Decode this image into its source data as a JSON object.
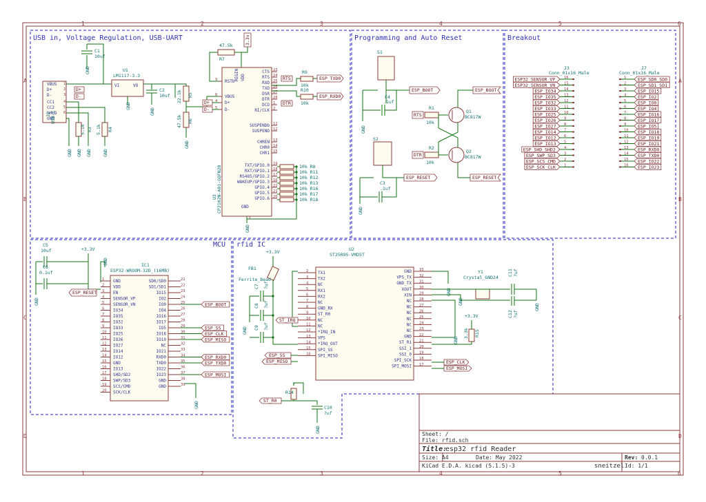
{
  "sections": {
    "usb": "USB in, Voltage Regulation, USB-UART",
    "prog": "Programming and Auto Reset",
    "breakout": "Breakout",
    "mcu": "MCU",
    "rfid": "rfid IC"
  },
  "grid": {
    "cols": [
      "1",
      "2",
      "3",
      "4",
      "5",
      "6"
    ],
    "rows": [
      "A",
      "B",
      "C",
      "D"
    ]
  },
  "usb": {
    "j2_ref": "J2",
    "j2_val": "USB-C",
    "j2_pins": [
      "VBUS",
      "D+",
      "D-",
      "CC1",
      "CC2",
      "SHLD",
      "GND"
    ],
    "j2_nums": [
      "1",
      "2",
      "3",
      "4",
      "5",
      "6"
    ],
    "u1_ref": "U1",
    "u1_val": "LM1117-3.3",
    "u1_vi": "VI",
    "u1_vo": "VO",
    "c1_ref": "C1",
    "c1_val": "10uf",
    "c2_ref": "C2",
    "c2_val": "10uf",
    "r5": "R5",
    "r5_val": "22.1k",
    "r6": "R6",
    "r6_val": "47.5k",
    "r3": "R3",
    "r3_val": "5.1k",
    "r4": "R4",
    "r4_val": "5.1k",
    "r7": "R7",
    "r7_val": "47.5k",
    "rail": "3.3v",
    "gnd": "GND",
    "dp": "D+",
    "dm": "D-",
    "u3_ref": "U3",
    "u3_val": "CP2102N-A01-GQFN28",
    "u3_left": [
      "REGIN",
      "VDD",
      "RSTb",
      "VBUS",
      "D+",
      "D-"
    ],
    "u3_left_nums": [
      "7",
      "6",
      "9",
      "8",
      "4",
      "5"
    ],
    "u3_right": [
      "CTS",
      "RTS",
      "RXD",
      "TXD",
      "DSR",
      "DTR",
      "DCD",
      "RI/CLK",
      "SUSPENDb",
      "SUSPEND",
      "CHREN",
      "CHR0",
      "CHR1",
      "TXT/GPIO.0",
      "RXT/GPIO.1",
      "RS485/GPIO.2",
      "WAKEUP/GPIO.3",
      "GPIO.4",
      "GPIO.5",
      "GPIO.6",
      "GND"
    ],
    "u3_right_nums": [
      "23",
      "24",
      "25",
      "26",
      "27",
      "28",
      "1",
      "2",
      "11",
      "12",
      "13",
      "14",
      "15",
      "19",
      "18",
      "17",
      "16",
      "22",
      "21",
      "20",
      "3"
    ],
    "r8_r18": [
      "10k R8",
      "10k R11",
      "10k R12",
      "10k R13",
      "10k R16",
      "10k R17",
      "10k R18"
    ],
    "r9": "R9",
    "r9_val": "10k",
    "r10": "R10",
    "r10_val": "10k",
    "esp_txd0": "ESP_TXD0",
    "esp_rxd0": "ESP_RXD0",
    "rts": "RTS",
    "dtr": "DTR"
  },
  "prog": {
    "s1": "S1",
    "s2": "S2",
    "c4": "C4",
    "c4_val": ".1uf",
    "c3": "C3",
    "c3_val": ".1uf",
    "r1": "R1",
    "r1_val": "10k",
    "r2": "R2",
    "r2_val": "10k",
    "q1": "Q1",
    "q1_val": "BC817W",
    "q2": "Q2",
    "q2_val": "BC817W",
    "esp_boot": "ESP_BOOT",
    "esp_reset": "ESP_RESET",
    "rts": "RTS",
    "dtr": "DTR",
    "gnd": "GND"
  },
  "breakout": {
    "j3_ref": "J3",
    "j3_val": "Conn_01x16_Male",
    "j3_labels": [
      "ESP32_SENSOR_VP",
      "ESP32_SENSOR_VN",
      "ESP_IO34",
      "ESP_IO35",
      "ESP_IO32",
      "ESP_IO33",
      "ESP_IO25",
      "ESP_IO26",
      "ESP_IO27",
      "ESP_IO14",
      "ESP_IO12",
      "ESP_IO13",
      "ESP_SHD_SHD2",
      "ESP_SWP_SD3",
      "ESP_SCS_CMD",
      "ESP_SCK_CLK"
    ],
    "j3_nums": [
      "16",
      "15",
      "14",
      "13",
      "12",
      "11",
      "10",
      "9",
      "8",
      "7",
      "6",
      "5",
      "4",
      "3",
      "2",
      "1"
    ],
    "j7_ref": "J7",
    "j7_val": "Conn_01x16_Male",
    "j7_labels": [
      "ESP_SD0_SD0",
      "ESP_SD1_SD1",
      "ESP_IO15",
      "ESP_IO2",
      "ESP_IO0",
      "ESP_IO4",
      "ESP_IO16",
      "ESP_IO17",
      "ESP_IO5",
      "ESP_IO18",
      "ESP_IO19",
      "ESP_IO21",
      "ESP_RXD0",
      "ESP_TXD0",
      "ESP_IO22",
      "ESP_IO23"
    ],
    "j7_nums": [
      "1",
      "2",
      "3",
      "4",
      "5",
      "6",
      "7",
      "8",
      "9",
      "10",
      "11",
      "12",
      "13",
      "14",
      "15",
      "16"
    ]
  },
  "mcu": {
    "c5": "C5",
    "c5_val": "10uf",
    "c6": "C6",
    "c6_val": "0.1uf",
    "rail": "+3.3V",
    "ic1_ref": "IC1",
    "ic1_val": "ESP32-WROOM-32D_(16MB)",
    "left_pins": [
      "GND",
      "VDD",
      "EN",
      "SENSOR_VP",
      "SENSOR_VN",
      "IO34",
      "IO35",
      "IO32",
      "IO33",
      "IO25",
      "IO26",
      "IO27",
      "IO14",
      "IO12",
      "GND",
      "IO13",
      "SHD/SD2",
      "SWP/SD3",
      "SCS/CMD",
      "SCK/CLK"
    ],
    "left_nums": [
      "1",
      "2",
      "3",
      "4",
      "5",
      "6",
      "7",
      "8",
      "9",
      "10",
      "11",
      "12",
      "13",
      "14",
      "15",
      "16",
      "17",
      "18",
      "19",
      "20"
    ],
    "right_pins": [
      "SD0/SD0",
      "SD1/SD1",
      "IO15",
      "IO2",
      "IO0",
      "IO4",
      "IO16",
      "IO17",
      "IO5",
      "IO18",
      "IO19",
      "NC",
      "IO21",
      "RXD0",
      "TXD0",
      "IO22",
      "IO23",
      "GND",
      "GND"
    ],
    "right_nums": [
      "21",
      "22",
      "23",
      "24",
      "25",
      "26",
      "27",
      "28",
      "29",
      "30",
      "31",
      "32",
      "33",
      "34",
      "35",
      "36",
      "37",
      "38",
      "39"
    ],
    "esp_reset": "ESP_RESET",
    "esp_boot": "ESP_BOOT",
    "esp_ss": "ESP_SS",
    "esp_clk": "ESP_CLK",
    "esp_miso": "ESP_MISO",
    "esp_rxd0": "ESP_RXD0",
    "esp_txd0": "ESP_TXD0",
    "esp_mosi": "ESP_MOSI",
    "gnd": "GND"
  },
  "rfid": {
    "u2_ref": "U2",
    "u2_val": "ST25R95-VMD5T",
    "rail": "+3.3V",
    "fb1": "FB1",
    "fb1_val": "Ferrite_Bead",
    "c7": "C7",
    "c7_val": "?uf",
    "c8": "C8",
    "c8_val": "?uf",
    "c9": "C9",
    "c9_val": "?uf",
    "c10": "C10",
    "c10_val": "?uf",
    "c11": "C11",
    "c11_val": "?uf",
    "c12": "C12",
    "c12_val": "?uf",
    "y1": "Y1",
    "y1_val": "Crystal_GND24",
    "r14": "R14",
    "r14_val": "?",
    "r15": "R15",
    "r15_val": "3.3k",
    "st_r0": "ST_R0",
    "left_pins": [
      "TX1",
      "TX2",
      "NC",
      "RX1",
      "RX2",
      "NC",
      "GND_RX",
      "ST_R0",
      "NC",
      "NC",
      "*IRQ_IN",
      "VPS",
      "*IRQ_OUT",
      "SPI_SS",
      "SPI_MISO"
    ],
    "left_nums": [
      "2",
      "3",
      "4",
      "5",
      "6",
      "7",
      "8",
      "9",
      "10",
      "11",
      "12",
      "13",
      "14",
      "15",
      "16"
    ],
    "right_pins": [
      "GND",
      "VPS_TX",
      "GND_TX",
      "XOUT",
      "XIN",
      "NC",
      "NC",
      "NC",
      "NC",
      "NC",
      "NC",
      "GND",
      "ST_R1",
      "SSI_1",
      "SSI_0",
      "SPI_SCK",
      "SPI_MOSI"
    ],
    "right_nums": [
      "33",
      "32",
      "31",
      "30",
      "29",
      "28",
      "27",
      "26",
      "25",
      "24",
      "23",
      "22",
      "21",
      "20",
      "19",
      "18",
      "17"
    ],
    "esp_ss": "ESP_SS",
    "esp_miso": "ESP_MISO",
    "esp_clk": "ESP_CLK",
    "esp_mosi": "ESP_MOSI",
    "gnd": "GND",
    "st_irq": "ST_IRQ"
  },
  "title_block": {
    "sheet": "Sheet: /",
    "file": "File: rfid.sch",
    "title_label": "Title:",
    "title": "esp32 rfid Reader",
    "size": "Size: A4",
    "date": "Date: May 2022",
    "rev_label": "Rev:",
    "rev": "0.0.1",
    "kicad": "KiCad E.D.A.  kicad (5.1.5)-3",
    "author": "sneitzel",
    "id": "Id: 1/1"
  }
}
